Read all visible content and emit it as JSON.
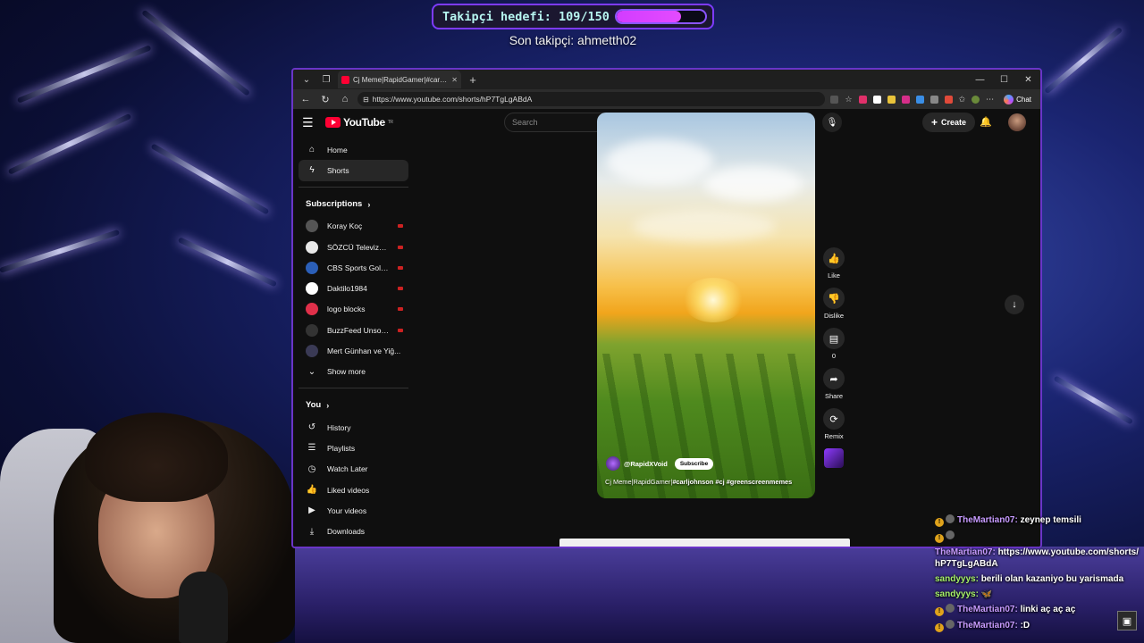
{
  "overlay": {
    "goal_label": "Takipçi hedefi: 109/150",
    "goal_progress": 0.7267,
    "last_follower": "Son takipçi: ahmetth02"
  },
  "browser": {
    "tab_title": "Cj Meme|RapidGamer|#carljohnson",
    "url": "https://www.youtube.com/shorts/hP7TgLgABdA",
    "chat_label": "Chat"
  },
  "youtube": {
    "logo_text": "YouTube",
    "logo_sup": "TR",
    "search_placeholder": "Search",
    "create_label": "Create",
    "sidebar": {
      "main": [
        {
          "label": "Home",
          "icon": "home-icon"
        },
        {
          "label": "Shorts",
          "icon": "shorts-icon"
        }
      ],
      "subscriptions_heading": "Subscriptions",
      "subscriptions": [
        {
          "label": "Koray Koç",
          "color": "#555555",
          "live": true
        },
        {
          "label": "SÖZCÜ Televizyo...",
          "color": "#e8e8e8",
          "live": true
        },
        {
          "label": "CBS Sports Gola...",
          "color": "#2b5fb8",
          "live": true
        },
        {
          "label": "Daktilo1984",
          "color": "#ffffff",
          "live": true
        },
        {
          "label": "logo blocks",
          "color": "#e0304a",
          "live": true
        },
        {
          "label": "BuzzFeed Unsolv...",
          "color": "#333333",
          "live": true
        },
        {
          "label": "Mert Günhan ve Yiğ...",
          "color": "#3a3a55",
          "live": false
        }
      ],
      "show_more": "Show more",
      "you_heading": "You",
      "you": [
        {
          "label": "History",
          "icon": "history-icon"
        },
        {
          "label": "Playlists",
          "icon": "playlists-icon"
        },
        {
          "label": "Watch Later",
          "icon": "watch-later-icon"
        },
        {
          "label": "Liked videos",
          "icon": "liked-videos-icon"
        },
        {
          "label": "Your videos",
          "icon": "your-videos-icon"
        },
        {
          "label": "Downloads",
          "icon": "downloads-icon"
        }
      ]
    },
    "short": {
      "channel": "@RapidXVoid",
      "subscribe": "Subscribe",
      "title_plain": "Cj Meme|RapidGamer|",
      "title_tags": "#carljohnson #cj #greenscreenmemes"
    },
    "actions": {
      "like": "Like",
      "dislike": "Dislike",
      "comments": "0",
      "share": "Share",
      "remix": "Remix"
    }
  },
  "chat": [
    {
      "user": "TheMartian07:",
      "text": "zeynep temsili",
      "color": "purple",
      "badges": true
    },
    {
      "user": "",
      "text": "",
      "color": "purple",
      "badges": true
    },
    {
      "user": "TheMartian07:",
      "text": "https://www.youtube.com/shorts/hP7TgLgABdA",
      "color": "purple",
      "badges": false
    },
    {
      "user": "sandyyys:",
      "text": "berili olan kazaniyo bu yarismada",
      "color": "green",
      "badges": false
    },
    {
      "user": "sandyyys:",
      "text": "🦋",
      "color": "green",
      "badges": false
    },
    {
      "user": "TheMartian07:",
      "text": "linki aç aç aç",
      "color": "purple",
      "badges": true
    },
    {
      "user": "TheMartian07:",
      "text": ":D",
      "color": "purple",
      "badges": true
    }
  ]
}
